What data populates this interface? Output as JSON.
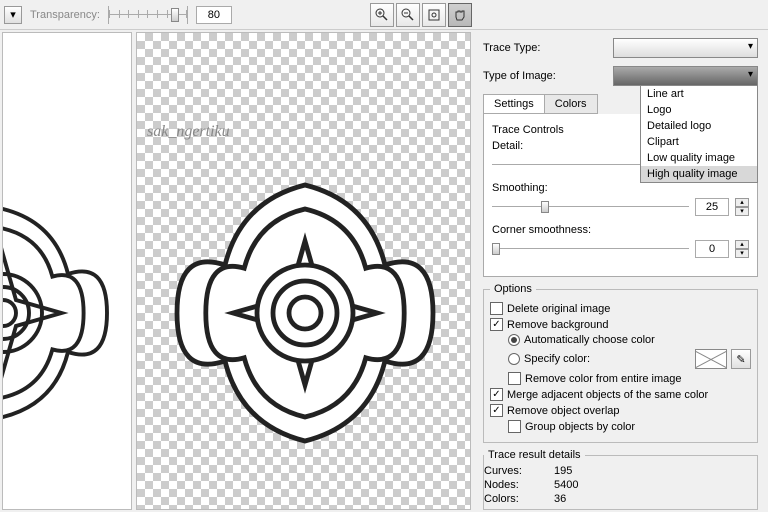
{
  "toolbar": {
    "transparency_label": "Transparency:",
    "transparency_value": "80"
  },
  "watermark": "sak_ngertiku",
  "panel": {
    "trace_type_label": "Trace Type:",
    "type_of_image_label": "Type of Image:",
    "image_type_options": {
      "o0": "Line art",
      "o1": "Logo",
      "o2": "Detailed logo",
      "o3": "Clipart",
      "o4": "Low quality image",
      "o5": "High quality image"
    },
    "tabs": {
      "settings": "Settings",
      "colors": "Colors"
    },
    "trace_controls": "Trace Controls",
    "detail_label": "Detail:",
    "smoothing_label": "Smoothing:",
    "smoothing_value": "25",
    "corner_label": "Corner smoothness:",
    "corner_value": "0",
    "options_legend": "Options",
    "delete_original": "Delete original image",
    "remove_bg": "Remove background",
    "auto_color": "Automatically choose color",
    "specify_color": "Specify color:",
    "remove_color_entire": "Remove color from entire image",
    "merge_adjacent": "Merge adjacent objects of the same color",
    "remove_overlap": "Remove object overlap",
    "group_by_color": "Group objects by color",
    "results_legend": "Trace result details",
    "curves_label": "Curves:",
    "curves_value": "195",
    "nodes_label": "Nodes:",
    "nodes_value": "5400",
    "colors_label": "Colors:",
    "colors_value": "36"
  }
}
